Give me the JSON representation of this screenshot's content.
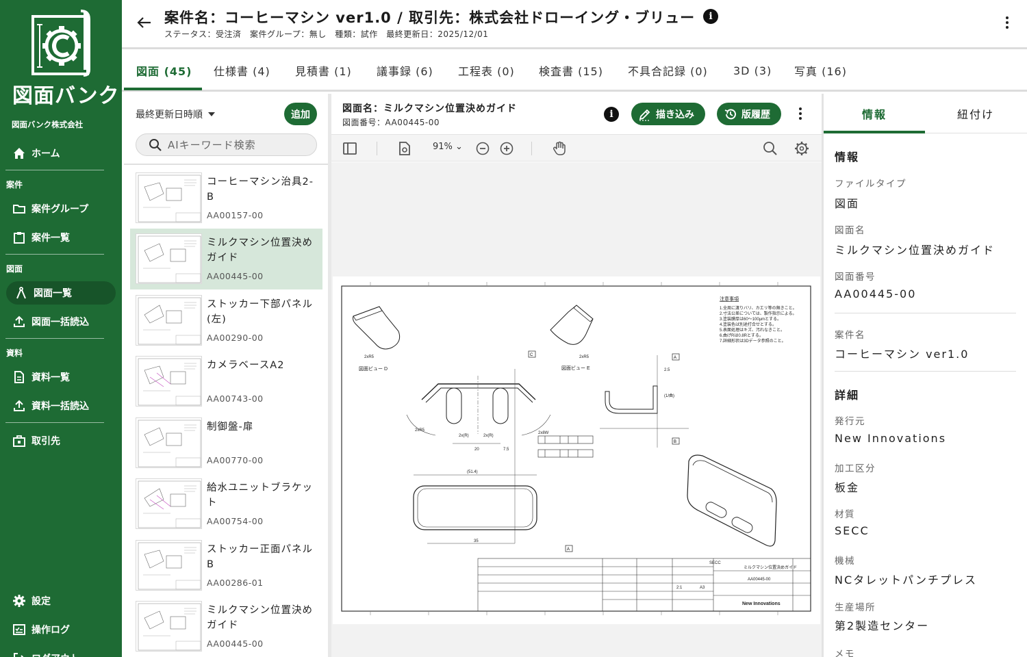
{
  "brand": {
    "logo_text": "図面バンク",
    "company": "図面バンク株式会社"
  },
  "nav": {
    "home": "ホーム",
    "section_cases": "案件",
    "case_group": "案件グループ",
    "case_list": "案件一覧",
    "section_drawings": "図面",
    "drawing_list": "図面一覧",
    "drawing_bulk_import": "図面一括読込",
    "section_docs": "資料",
    "doc_list": "資料一覧",
    "doc_bulk_import": "資料一括読込",
    "clients": "取引先",
    "settings": "設定",
    "op_log": "操作ログ",
    "logout": "ログアウト"
  },
  "header": {
    "title": "案件名：コーヒーマシン ver1.0 / 取引先：株式会社ドローイング・ブリュー",
    "subtitle": "ステータス：受注済　案件グループ：無し　種類：試作　最終更新日：2025/12/01"
  },
  "tabs": [
    {
      "label": "図面 (45)"
    },
    {
      "label": "仕様書 (4)"
    },
    {
      "label": "見積書 (1)"
    },
    {
      "label": "議事録 (6)"
    },
    {
      "label": "工程表 (0)"
    },
    {
      "label": "検査書 (15)"
    },
    {
      "label": "不具合記録 (0)"
    },
    {
      "label": "3D (3)"
    },
    {
      "label": "写真 (16)"
    }
  ],
  "list": {
    "sort_label": "最終更新日時順",
    "add_label": "追加",
    "search_placeholder": "AIキーワード検索",
    "items": [
      {
        "name": "コーヒーマシン治具2-B",
        "code": "AA00157-00"
      },
      {
        "name": "ミルクマシン位置決めガイド",
        "code": "AA00445-00"
      },
      {
        "name": "ストッカー下部パネル(左)",
        "code": "AA00290-00"
      },
      {
        "name": "カメラベースA2",
        "code": "AA00743-00"
      },
      {
        "name": "制御盤-扉",
        "code": "AA00770-00"
      },
      {
        "name": "給水ユニットブラケット",
        "code": "AA00754-00"
      },
      {
        "name": "ストッカー正面パネルB",
        "code": "AA00286-01"
      },
      {
        "name": "ミルクマシン位置決めガイド",
        "code": "AA00445-00"
      }
    ]
  },
  "viewer": {
    "name": "図面名：ミルクマシン位置決めガイド",
    "code": "図面番号：AA00445-00",
    "draw_label": "描き込み",
    "history_label": "版履歴",
    "zoom": "91%",
    "drawing_text": {
      "notes_title": "注意事項",
      "notes": [
        "1.全周に渡りバリ、カエリ等の無きこと。",
        "2.寸法公差については、製作指示による。",
        "3.塗装膜厚は60〜100μmとする。",
        "4.塗装色は別途打合せとする。",
        "5.表面処理はキズ、汚れなきこと。",
        "6.曲げRは0.8Rとする。",
        "7.詳細形状は3Dデータ参照のこと。"
      ],
      "view_d": "図面ビュー D",
      "view_e": "図面ビュー E",
      "brand": "New Innovations",
      "tb_name": "ミルクマシン位置決めガイド",
      "tb_code": "AA00445-00",
      "tb_material": "SECC",
      "tb_size": "A3",
      "tb_scale": "2:1"
    }
  },
  "info": {
    "tab_info": "情報",
    "tab_link": "紐付け",
    "section_info": "情報",
    "fields": [
      {
        "label": "ファイルタイプ",
        "value": "図面"
      },
      {
        "label": "図面名",
        "value": "ミルクマシン位置決めガイド"
      },
      {
        "label": "図面番号",
        "value": "AA00445-00"
      },
      {
        "label": "案件名",
        "value": "コーヒーマシン ver1.0"
      }
    ],
    "section_detail": "詳細",
    "details": [
      {
        "label": "発行元",
        "value": "New Innovations"
      },
      {
        "label": "加工区分",
        "value": "板金"
      },
      {
        "label": "材質",
        "value": "SECC"
      },
      {
        "label": "機械",
        "value": "NCタレットパンチプレス"
      },
      {
        "label": "生産場所",
        "value": "第2製造センター"
      }
    ],
    "memo_label": "メモ"
  },
  "colors": {
    "brand_green": "#1e6b34",
    "selected_bg": "#d6e7da"
  }
}
